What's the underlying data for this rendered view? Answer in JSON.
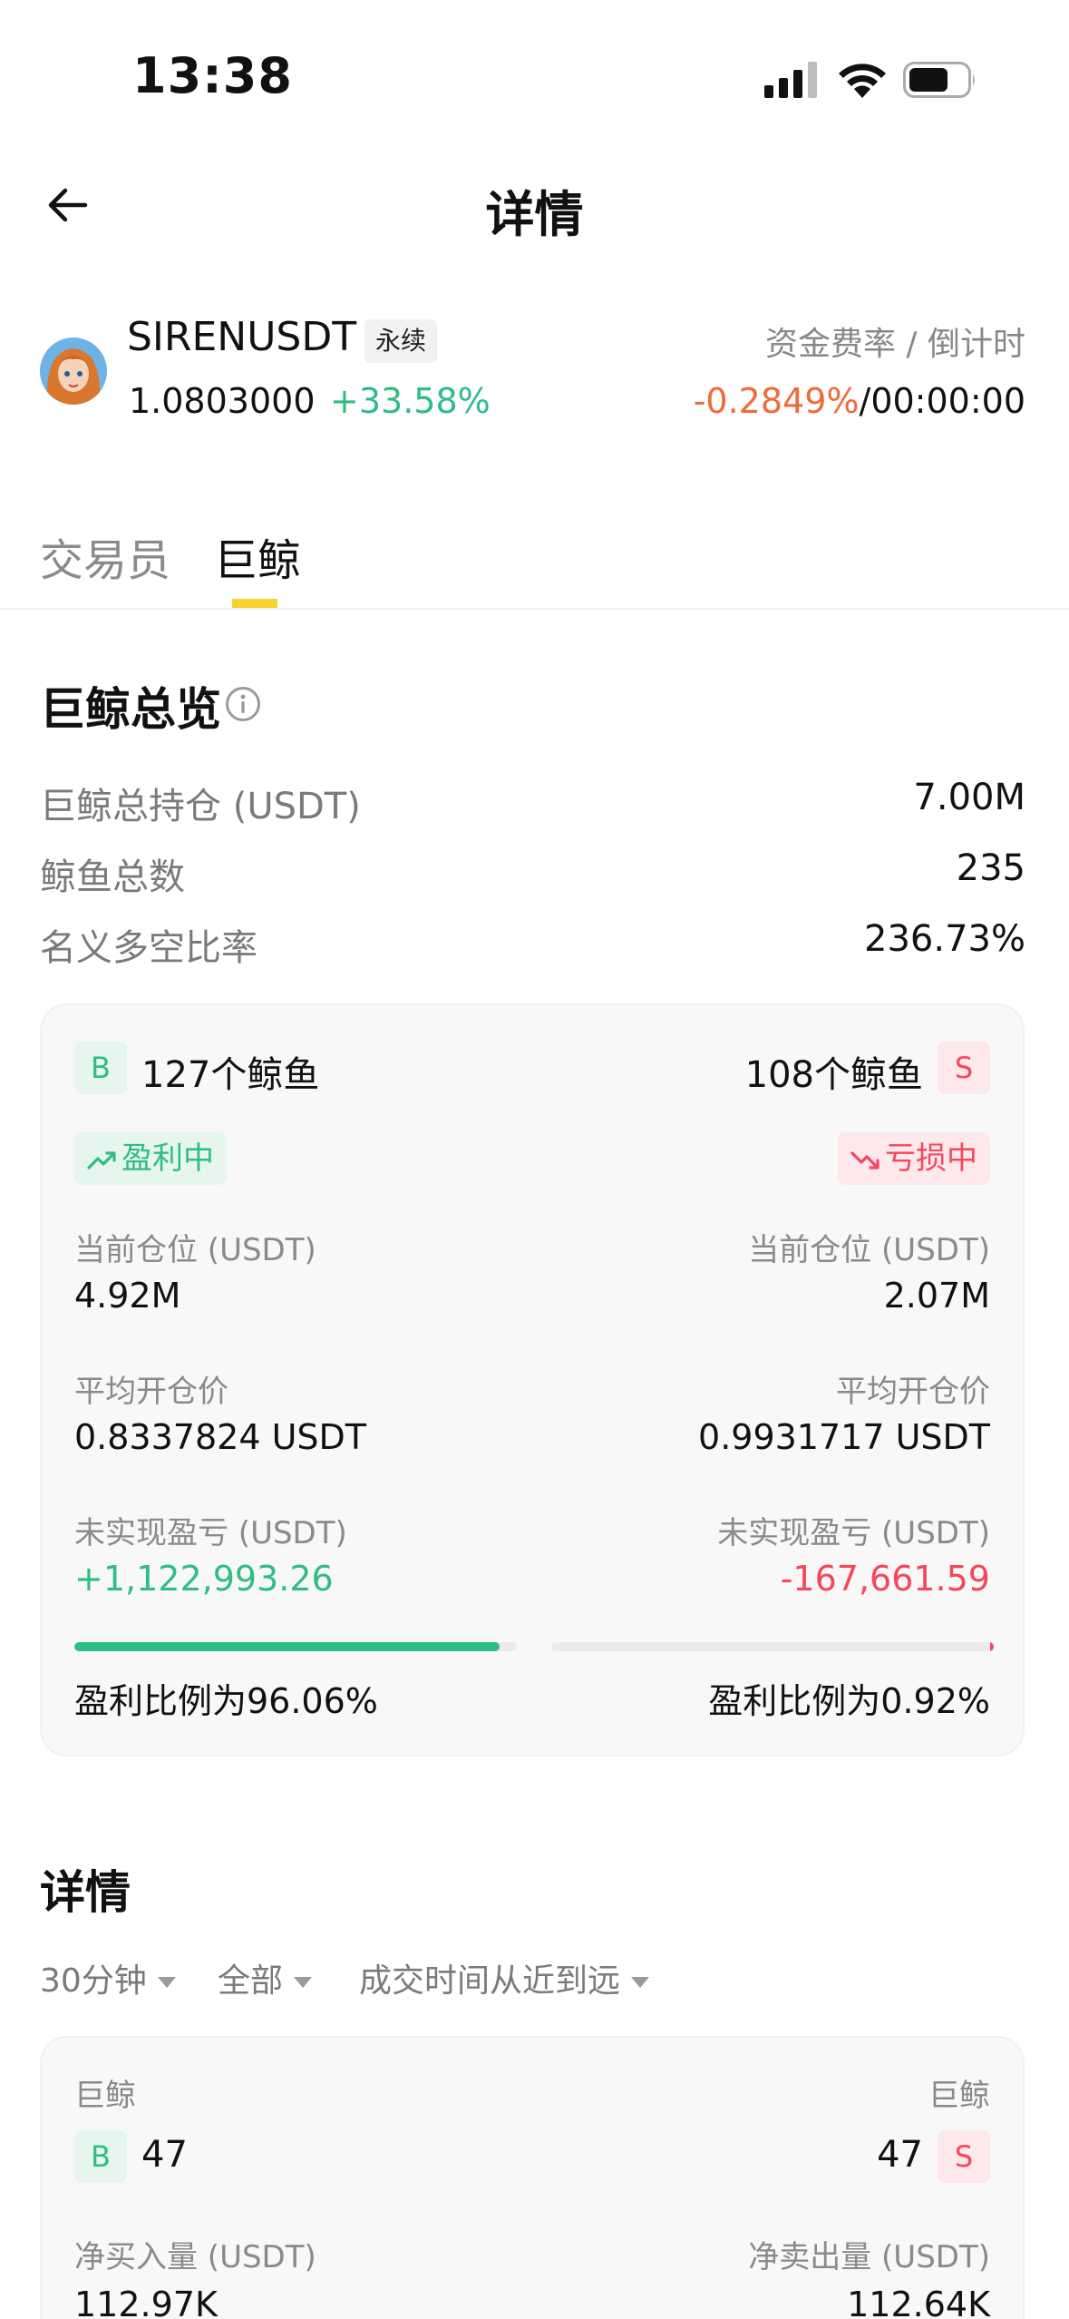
{
  "status_bar": {
    "time": "13:38"
  },
  "header": {
    "title": "详情"
  },
  "symbol": {
    "name": "SIRENUSDT",
    "badge": "永续",
    "price": "1.0803000",
    "change": "+33.58%",
    "funding_label": "资金费率 / 倒计时",
    "funding_rate": "-0.2849%",
    "separator": "/",
    "countdown": "00:00:00"
  },
  "tabs": [
    {
      "label": "交易员",
      "active": false
    },
    {
      "label": "巨鲸",
      "active": true
    }
  ],
  "overview": {
    "title": "巨鲸总览",
    "rows": [
      {
        "label": "巨鲸总持仓 (USDT)",
        "value": "7.00M"
      },
      {
        "label": "鲸鱼总数",
        "value": "235"
      },
      {
        "label": "名义多空比率",
        "value": "236.73%"
      }
    ]
  },
  "whale_card": {
    "long": {
      "badge": "B",
      "count": "127个鲸鱼",
      "status": "盈利中",
      "position_label": "当前仓位 (USDT)",
      "position_value": "4.92M",
      "avg_price_label": "平均开仓价",
      "avg_price_value": "0.8337824 USDT",
      "pnl_label": "未实现盈亏 (USDT)",
      "pnl_value": "+1,122,993.26",
      "profit_ratio_text": "盈利比例为96.06%",
      "profit_ratio": 96.06
    },
    "short": {
      "badge": "S",
      "count": "108个鲸鱼",
      "status": "亏损中",
      "position_label": "当前仓位 (USDT)",
      "position_value": "2.07M",
      "avg_price_label": "平均开仓价",
      "avg_price_value": "0.9931717 USDT",
      "pnl_label": "未实现盈亏 (USDT)",
      "pnl_value": "-167,661.59",
      "profit_ratio_text": "盈利比例为0.92%",
      "profit_ratio": 0.92
    }
  },
  "details": {
    "title": "详情",
    "filters": [
      "30分钟",
      "全部",
      "成交时间从近到远"
    ],
    "card": {
      "left_label": "巨鲸",
      "right_label": "巨鲸",
      "left_badge": "B",
      "right_badge": "S",
      "left_count": "47",
      "right_count": "47",
      "buy_label": "净买入量 (USDT)",
      "sell_label": "净卖出量 (USDT)",
      "buy_value": "112.97K",
      "sell_value": "112.64K"
    }
  },
  "colors": {
    "green": "#2ebd85",
    "red": "#f6465d",
    "orange": "#f06a3a",
    "accent_yellow": "#f8d12f"
  }
}
